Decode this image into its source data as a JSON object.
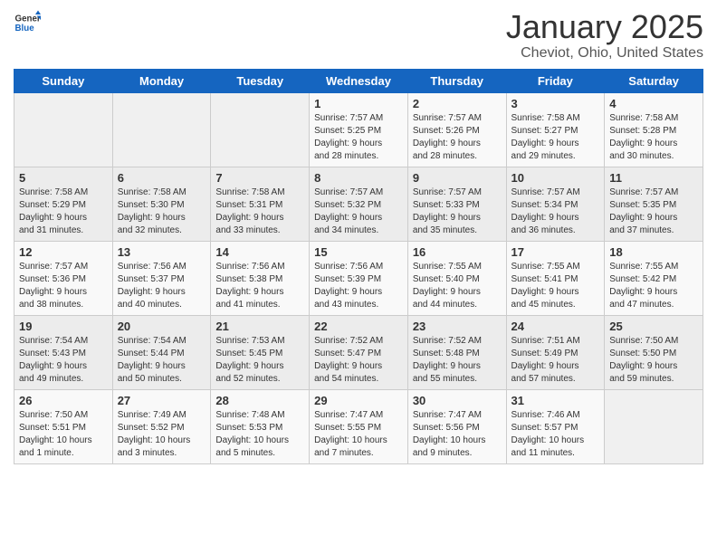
{
  "logo": {
    "line1": "General",
    "line2": "Blue"
  },
  "title": "January 2025",
  "subtitle": "Cheviot, Ohio, United States",
  "days_of_week": [
    "Sunday",
    "Monday",
    "Tuesday",
    "Wednesday",
    "Thursday",
    "Friday",
    "Saturday"
  ],
  "weeks": [
    [
      {
        "day": "",
        "info": ""
      },
      {
        "day": "",
        "info": ""
      },
      {
        "day": "",
        "info": ""
      },
      {
        "day": "1",
        "info": "Sunrise: 7:57 AM\nSunset: 5:25 PM\nDaylight: 9 hours\nand 28 minutes."
      },
      {
        "day": "2",
        "info": "Sunrise: 7:57 AM\nSunset: 5:26 PM\nDaylight: 9 hours\nand 28 minutes."
      },
      {
        "day": "3",
        "info": "Sunrise: 7:58 AM\nSunset: 5:27 PM\nDaylight: 9 hours\nand 29 minutes."
      },
      {
        "day": "4",
        "info": "Sunrise: 7:58 AM\nSunset: 5:28 PM\nDaylight: 9 hours\nand 30 minutes."
      }
    ],
    [
      {
        "day": "5",
        "info": "Sunrise: 7:58 AM\nSunset: 5:29 PM\nDaylight: 9 hours\nand 31 minutes."
      },
      {
        "day": "6",
        "info": "Sunrise: 7:58 AM\nSunset: 5:30 PM\nDaylight: 9 hours\nand 32 minutes."
      },
      {
        "day": "7",
        "info": "Sunrise: 7:58 AM\nSunset: 5:31 PM\nDaylight: 9 hours\nand 33 minutes."
      },
      {
        "day": "8",
        "info": "Sunrise: 7:57 AM\nSunset: 5:32 PM\nDaylight: 9 hours\nand 34 minutes."
      },
      {
        "day": "9",
        "info": "Sunrise: 7:57 AM\nSunset: 5:33 PM\nDaylight: 9 hours\nand 35 minutes."
      },
      {
        "day": "10",
        "info": "Sunrise: 7:57 AM\nSunset: 5:34 PM\nDaylight: 9 hours\nand 36 minutes."
      },
      {
        "day": "11",
        "info": "Sunrise: 7:57 AM\nSunset: 5:35 PM\nDaylight: 9 hours\nand 37 minutes."
      }
    ],
    [
      {
        "day": "12",
        "info": "Sunrise: 7:57 AM\nSunset: 5:36 PM\nDaylight: 9 hours\nand 38 minutes."
      },
      {
        "day": "13",
        "info": "Sunrise: 7:56 AM\nSunset: 5:37 PM\nDaylight: 9 hours\nand 40 minutes."
      },
      {
        "day": "14",
        "info": "Sunrise: 7:56 AM\nSunset: 5:38 PM\nDaylight: 9 hours\nand 41 minutes."
      },
      {
        "day": "15",
        "info": "Sunrise: 7:56 AM\nSunset: 5:39 PM\nDaylight: 9 hours\nand 43 minutes."
      },
      {
        "day": "16",
        "info": "Sunrise: 7:55 AM\nSunset: 5:40 PM\nDaylight: 9 hours\nand 44 minutes."
      },
      {
        "day": "17",
        "info": "Sunrise: 7:55 AM\nSunset: 5:41 PM\nDaylight: 9 hours\nand 45 minutes."
      },
      {
        "day": "18",
        "info": "Sunrise: 7:55 AM\nSunset: 5:42 PM\nDaylight: 9 hours\nand 47 minutes."
      }
    ],
    [
      {
        "day": "19",
        "info": "Sunrise: 7:54 AM\nSunset: 5:43 PM\nDaylight: 9 hours\nand 49 minutes."
      },
      {
        "day": "20",
        "info": "Sunrise: 7:54 AM\nSunset: 5:44 PM\nDaylight: 9 hours\nand 50 minutes."
      },
      {
        "day": "21",
        "info": "Sunrise: 7:53 AM\nSunset: 5:45 PM\nDaylight: 9 hours\nand 52 minutes."
      },
      {
        "day": "22",
        "info": "Sunrise: 7:52 AM\nSunset: 5:47 PM\nDaylight: 9 hours\nand 54 minutes."
      },
      {
        "day": "23",
        "info": "Sunrise: 7:52 AM\nSunset: 5:48 PM\nDaylight: 9 hours\nand 55 minutes."
      },
      {
        "day": "24",
        "info": "Sunrise: 7:51 AM\nSunset: 5:49 PM\nDaylight: 9 hours\nand 57 minutes."
      },
      {
        "day": "25",
        "info": "Sunrise: 7:50 AM\nSunset: 5:50 PM\nDaylight: 9 hours\nand 59 minutes."
      }
    ],
    [
      {
        "day": "26",
        "info": "Sunrise: 7:50 AM\nSunset: 5:51 PM\nDaylight: 10 hours\nand 1 minute."
      },
      {
        "day": "27",
        "info": "Sunrise: 7:49 AM\nSunset: 5:52 PM\nDaylight: 10 hours\nand 3 minutes."
      },
      {
        "day": "28",
        "info": "Sunrise: 7:48 AM\nSunset: 5:53 PM\nDaylight: 10 hours\nand 5 minutes."
      },
      {
        "day": "29",
        "info": "Sunrise: 7:47 AM\nSunset: 5:55 PM\nDaylight: 10 hours\nand 7 minutes."
      },
      {
        "day": "30",
        "info": "Sunrise: 7:47 AM\nSunset: 5:56 PM\nDaylight: 10 hours\nand 9 minutes."
      },
      {
        "day": "31",
        "info": "Sunrise: 7:46 AM\nSunset: 5:57 PM\nDaylight: 10 hours\nand 11 minutes."
      },
      {
        "day": "",
        "info": ""
      }
    ]
  ]
}
